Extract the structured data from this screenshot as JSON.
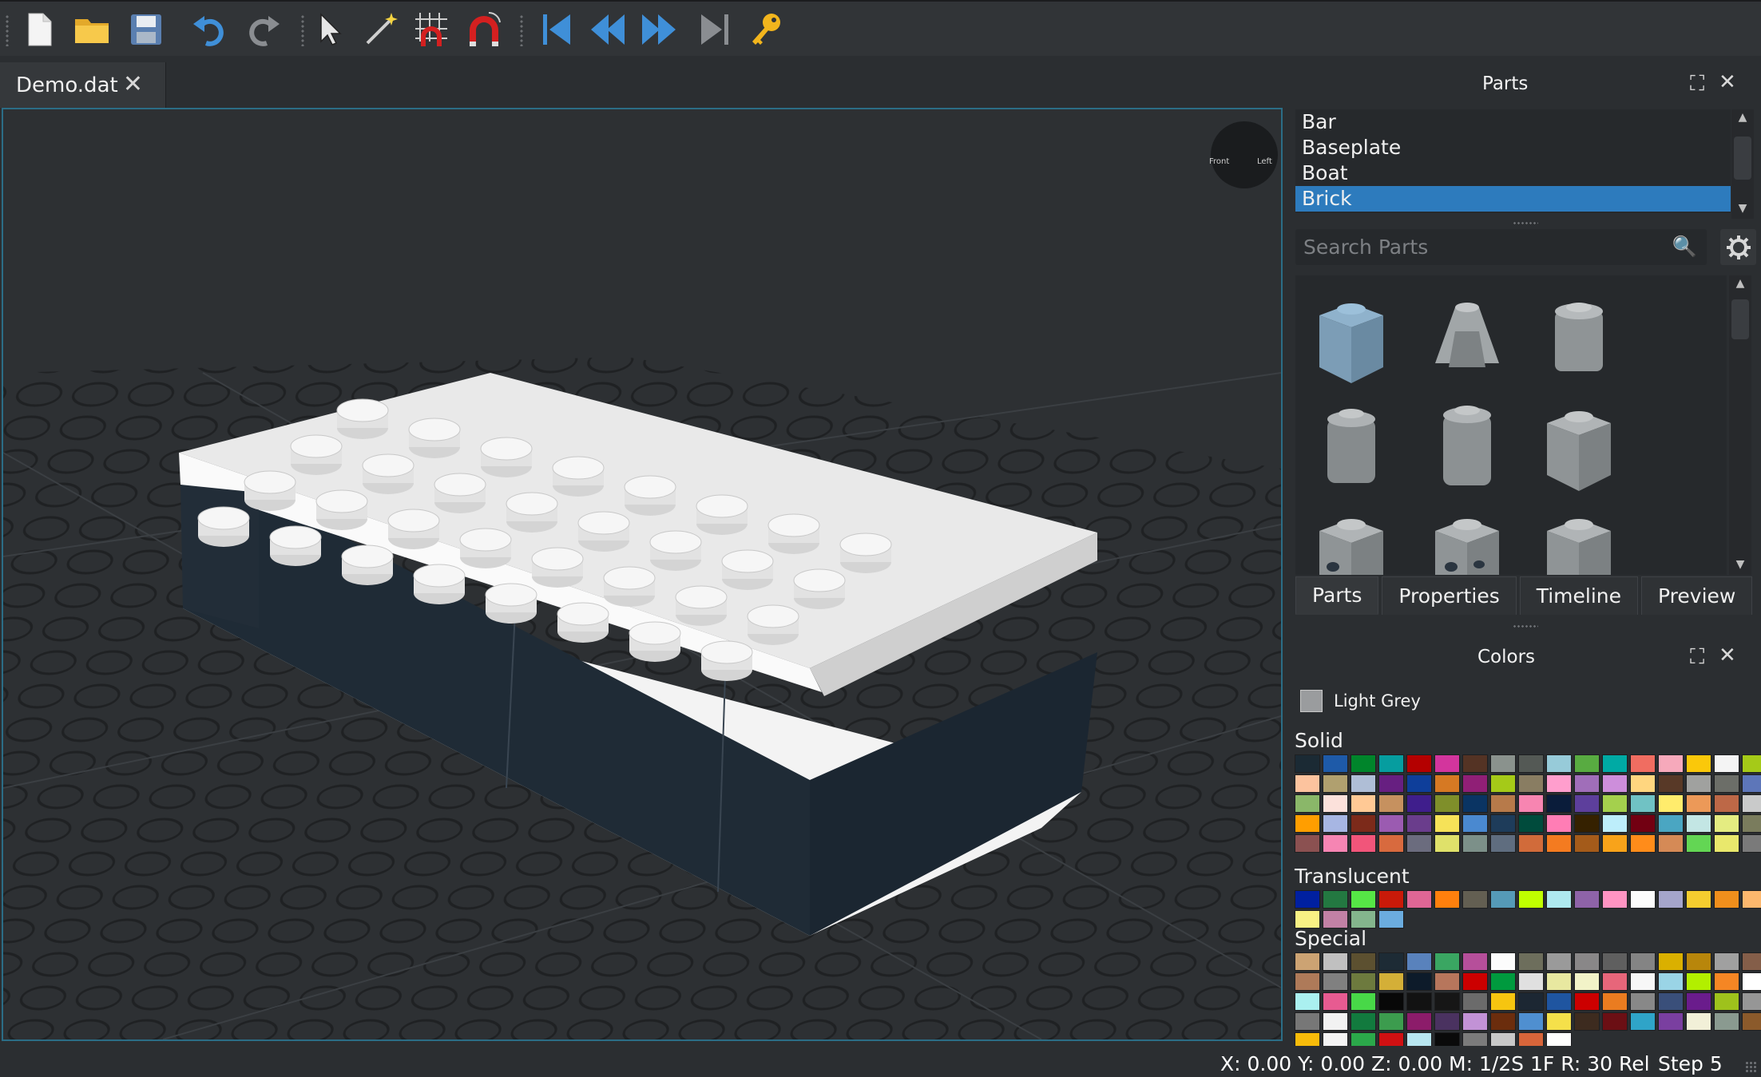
{
  "toolbar": {
    "icons": [
      "new-file-icon",
      "open-folder-icon",
      "save-icon",
      "undo-icon",
      "redo-icon",
      "select-arrow-icon",
      "magic-wand-icon",
      "grid-snap-icon",
      "magnet-icon",
      "magnet-rotate-icon",
      "first-step-icon",
      "previous-step-icon",
      "next-step-icon",
      "last-step-icon",
      "key-icon"
    ]
  },
  "document_tab": {
    "title": "Demo.dat",
    "close": "✕"
  },
  "viewport": {
    "compass_labels": [
      "Front",
      "Left"
    ]
  },
  "parts_panel": {
    "title": "Parts",
    "categories": [
      "Bar",
      "Baseplate",
      "Boat",
      "Brick"
    ],
    "selected_category": "Brick",
    "search_placeholder": "Search Parts",
    "tabs": [
      "Parts",
      "Properties",
      "Timeline",
      "Preview"
    ],
    "active_tab": "Parts"
  },
  "colors_panel": {
    "title": "Colors",
    "current_color": {
      "name": "Light Grey",
      "hex": "#9a9c9e"
    },
    "sections": [
      {
        "name": "Solid",
        "colors": [
          "#1b2a34",
          "#1e5aa8",
          "#00852b",
          "#069d9f",
          "#b40000",
          "#d3359d",
          "#543324",
          "#8a928d",
          "#545955",
          "#97cbd9",
          "#58ab41",
          "#00aaa4",
          "#f06d61",
          "#f6a9bb",
          "#fac80a",
          "#f4f4f4",
          "#a5ca18",
          "#fcc39e",
          "#b0a06f",
          "#afbed6",
          "#671f81",
          "#0e3e9a",
          "#d67923",
          "#901f76",
          "#a5ca18",
          "#897d62",
          "#ff9ecd",
          "#a06eb9",
          "#cd8edb",
          "#ffd67f",
          "#583927",
          "#a0a19f",
          "#6c6e68",
          "#5d76b9",
          "#8ab769",
          "#fce1db",
          "#ffc995",
          "#c6915f",
          "#3f1e8c",
          "#7f8f2a",
          "#0a3463",
          "#b77a4a",
          "#f785b1",
          "#0a1c3a",
          "#5d3f9c",
          "#a4d04d",
          "#70c2c4",
          "#ffec6c",
          "#ec9958",
          "#bd6847",
          "#c9caca",
          "#ff9e00",
          "#a7b6e3",
          "#7c2a1a",
          "#9b5bb1",
          "#6a3d8c",
          "#f6e258",
          "#4a89d0",
          "#1e3c5a",
          "#004b3c",
          "#ff7db5",
          "#352100",
          "#bdeefb",
          "#720012",
          "#4aa6c2",
          "#c3e6e4",
          "#e4ec81",
          "#7a7c5d",
          "#8b5151",
          "#f685b3",
          "#f1557a",
          "#d86a3e",
          "#6b6c7e",
          "#dfe16a",
          "#7c9089",
          "#5f6d7f",
          "#d16b3a",
          "#f47b20",
          "#a45b1a",
          "#f8a31a",
          "#ff8c1a",
          "#d58a56",
          "#63d654",
          "#e9e86c",
          "#7a7a7a"
        ]
      },
      {
        "name": "Translucent",
        "colors": [
          "#0020a0",
          "#237841",
          "#56e646",
          "#c91a09",
          "#df6695",
          "#ff800d",
          "#635f52",
          "#559ab7",
          "#c0ff00",
          "#aee9ef",
          "#8e63a8",
          "#ff94c2",
          "#fcfcfc",
          "#a5a5cb",
          "#f5cd2f",
          "#f08f1c",
          "#fcb76d",
          "#f8f184",
          "#c281a5",
          "#84b68d",
          "#6bacdf"
        ]
      },
      {
        "name": "Special",
        "colors": [
          "#cca373",
          "#c0c0c0",
          "#5c5030",
          "#1d2b35",
          "#5982bc",
          "#3aa662",
          "#b64f9a",
          "#fcfcfc",
          "#6d6e5c",
          "#9a9a9a",
          "#898788",
          "#5f5f5f",
          "#848484",
          "#dab000",
          "#b8860b",
          "#a0a0a0",
          "#845e49",
          "#ae7a59",
          "#808080",
          "#6d7a3e",
          "#d4af37",
          "#0d1b2a",
          "#b7765c",
          "#cc0000",
          "#009a3e",
          "#e0e0e0",
          "#e8e8a0",
          "#f2f3c8",
          "#e7667a",
          "#f7f7f7",
          "#9ad4e6",
          "#b2ef00",
          "#f58624",
          "#ffffff",
          "#aaf0f0",
          "#e75b91",
          "#48d848",
          "#080808",
          "#121212",
          "#161616",
          "#6b6b6b",
          "#f6c510",
          "#1c2733",
          "#1f55a0",
          "#cc0000",
          "#ea7c20",
          "#888888",
          "#3a4f7a",
          "#6a1c8c",
          "#9ec21c",
          "#969696",
          "#777777",
          "#f2f2f2",
          "#127a3e",
          "#3c9c4e",
          "#8c1c6a",
          "#4a3260",
          "#c292d6",
          "#6b2d0d",
          "#4f8fd0",
          "#f5e04a",
          "#3d2b1f",
          "#6b0f14",
          "#2fa4c8",
          "#7a3fa0",
          "#f2f0d8",
          "#8a9a90",
          "#8b5a2b",
          "#f8bc0a",
          "#f4f4f4",
          "#2ba84a",
          "#d01012",
          "#b8e6f0",
          "#0a0a0a",
          "#7b7b7b",
          "#c8c8c8",
          "#d8653a",
          "#ffffff"
        ]
      }
    ]
  },
  "status": {
    "coords": "X: 0.00 Y: 0.00 Z: 0.00",
    "mode": "M: 1/2S 1F R: 30 Rel",
    "step": "Step 5"
  }
}
